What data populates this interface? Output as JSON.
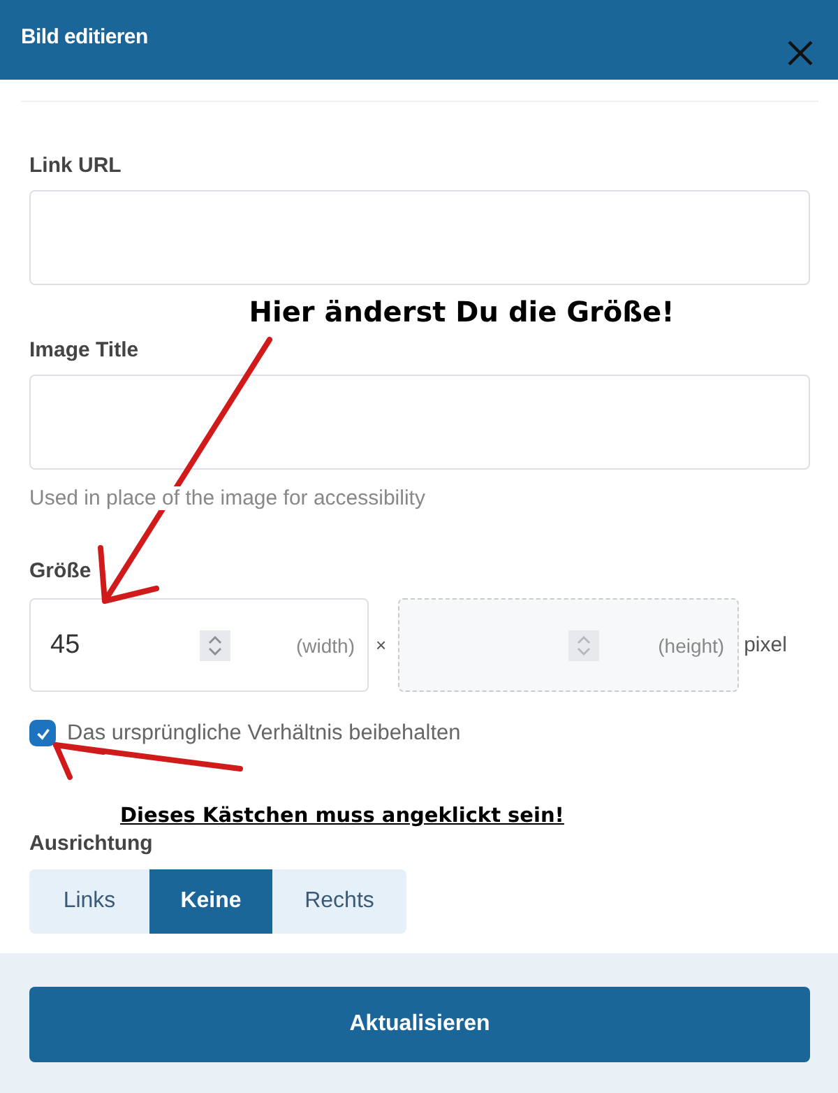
{
  "dialog": {
    "title": "Bild editieren"
  },
  "link_url": {
    "label": "Link URL"
  },
  "image_title": {
    "label": "Image Title",
    "help": "Used in place of the image for accessibility"
  },
  "size": {
    "label": "Größe",
    "width": {
      "value": "45",
      "unit": "(width)",
      "disabled": false
    },
    "separator": "×",
    "height": {
      "unit": "(height)",
      "disabled": true
    },
    "suffix": "pixel"
  },
  "keep_ratio": {
    "label": "Das ursprüngliche Verhältnis beibehalten",
    "checked": true
  },
  "alignment": {
    "label": "Ausrichtung",
    "options": [
      {
        "label": "Links",
        "selected": false
      },
      {
        "label": "Keine",
        "selected": true
      },
      {
        "label": "Rechts",
        "selected": false
      }
    ]
  },
  "submit": {
    "label": "Aktualisieren"
  },
  "annotations": [
    {
      "kind": "heading",
      "text": "Hier änderst Du die Größe!"
    },
    {
      "kind": "underlined",
      "text": "Dieses Kästchen muss angeklickt sein!"
    }
  ]
}
